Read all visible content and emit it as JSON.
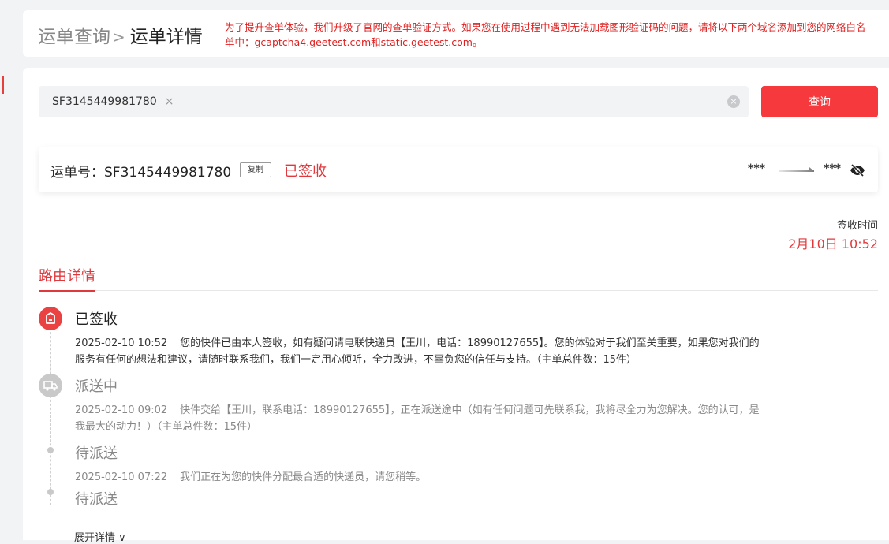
{
  "header": {
    "breadcrumb_parent": "运单查询",
    "breadcrumb_separator": ">",
    "breadcrumb_current": "运单详情",
    "notice": "为了提升查单体验，我们升级了官网的查单验证方式。如果您在使用过程中遇到无法加载图形验证码的问题，请将以下两个域名添加到您的网络白名单中：gcaptcha4.geetest.com和static.geetest.com。"
  },
  "search": {
    "tag_value": "SF3145449981780",
    "tag_remove": "×",
    "input_value": "",
    "clear_symbol": "×",
    "query_button": "查询"
  },
  "waybill": {
    "label": "运单号：SF3145449981780",
    "copy_button": "复制",
    "status": "已签收",
    "origin": "***",
    "destination": "***"
  },
  "sign": {
    "label": "签收时间",
    "time": "2月10日 10:52"
  },
  "tabs": {
    "active": "路由详情"
  },
  "timeline": [
    {
      "status": "已签收",
      "time": "2025-02-10 10:52",
      "desc": "您的快件已由本人签收，如有疑问请电联快递员【王川，电话：18990127655】。您的体验对于我们至关重要，如果您对我们的服务有任何的想法和建议，请随时联系我们，我们一定用心倾听，全力改进，不辜负您的信任与支持。（主单总件数：15件）"
    },
    {
      "status": "派送中",
      "time": "2025-02-10 09:02",
      "desc": "快件交给【王川，联系电话：18990127655】，正在派送途中（如有任何问题可先联系我，我将尽全力为您解决。您的认可，是我最大的动力！）（主单总件数：15件）"
    },
    {
      "status": "待派送",
      "time": "2025-02-10 07:22",
      "desc": "我们正在为您的快件分配最合适的快递员，请您稍等。"
    },
    {
      "status": "待派送",
      "time": "",
      "desc": ""
    }
  ],
  "expand": {
    "label": "展开详情",
    "chevron": "∨"
  },
  "colors": {
    "accent": "#e0393d",
    "button": "#f5393d",
    "notice": "#e02020"
  }
}
